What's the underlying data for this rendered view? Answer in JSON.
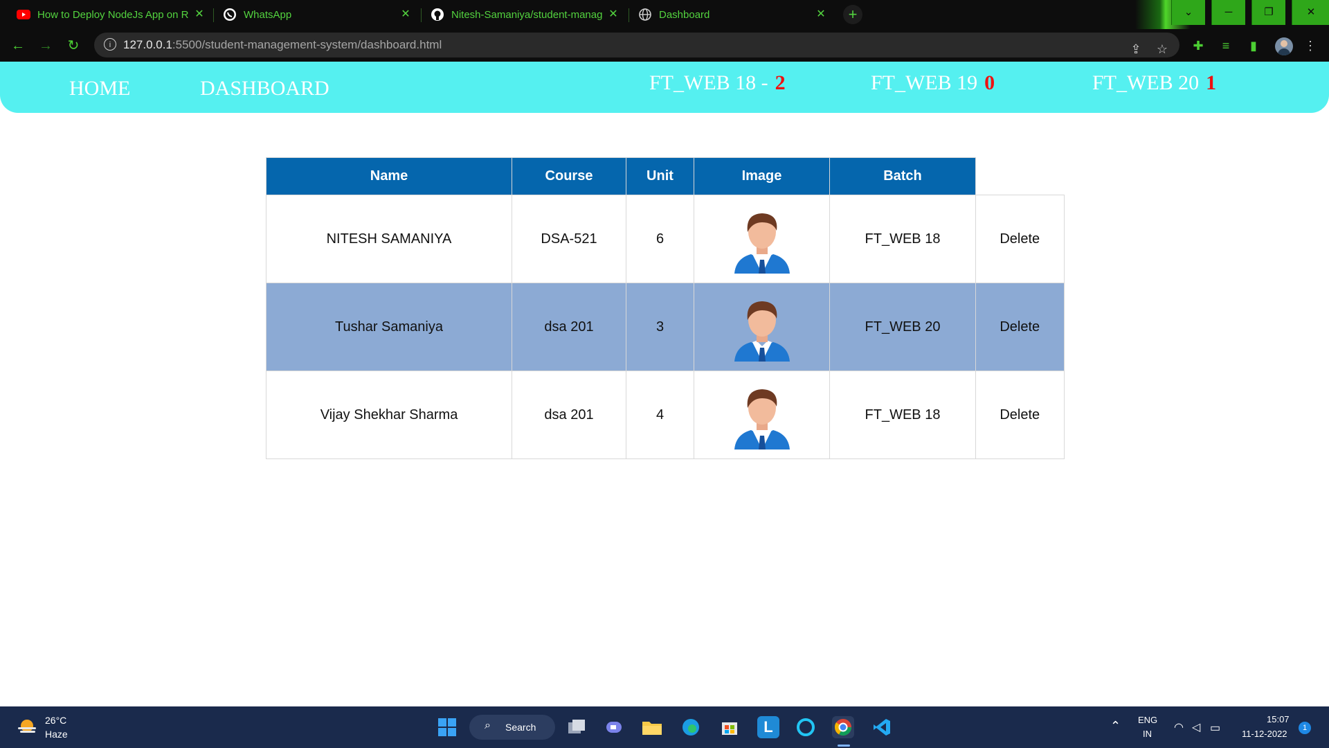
{
  "browser": {
    "tabs": [
      {
        "title": "How to Deploy NodeJs App on R",
        "icon": "youtube-icon"
      },
      {
        "title": "WhatsApp",
        "icon": "whatsapp-icon"
      },
      {
        "title": "Nitesh-Samaniya/student-manag",
        "icon": "github-icon"
      },
      {
        "title": "Dashboard",
        "icon": "globe-icon"
      }
    ],
    "new_tab_label": "+",
    "url_host": "127.0.0.1",
    "url_rest": ":5500/student-management-system/dashboard.html"
  },
  "nav": {
    "home": "HOME",
    "dashboard": "DASHBOARD",
    "batches": [
      {
        "label": "FT_WEB 18 -",
        "count": "2"
      },
      {
        "label": "FT_WEB 19",
        "count": "0"
      },
      {
        "label": "FT_WEB 20",
        "count": "1"
      }
    ]
  },
  "table": {
    "headers": [
      "Name",
      "Course",
      "Unit",
      "Image",
      "Batch"
    ],
    "rows": [
      {
        "name": "NITESH SAMANIYA",
        "course": "DSA-521",
        "unit": "6",
        "batch": "FT_WEB 18",
        "action": "Delete"
      },
      {
        "name": "Tushar Samaniya",
        "course": "dsa 201",
        "unit": "3",
        "batch": "FT_WEB 20",
        "action": "Delete"
      },
      {
        "name": "Vijay Shekhar Sharma",
        "course": "dsa 201",
        "unit": "4",
        "batch": "FT_WEB 18",
        "action": "Delete"
      }
    ]
  },
  "taskbar": {
    "weather_temp": "26°C",
    "weather_desc": "Haze",
    "search_label": "Search",
    "lang": "ENG",
    "region": "IN",
    "time": "15:07",
    "date": "11-12-2022",
    "notification_count": "1"
  },
  "colors": {
    "nav_bg": "#55f0f0",
    "header_bg": "#0566ad",
    "alt_row_bg": "#8caad4",
    "count_red": "#ee1111",
    "browser_accent": "#53d33f"
  }
}
